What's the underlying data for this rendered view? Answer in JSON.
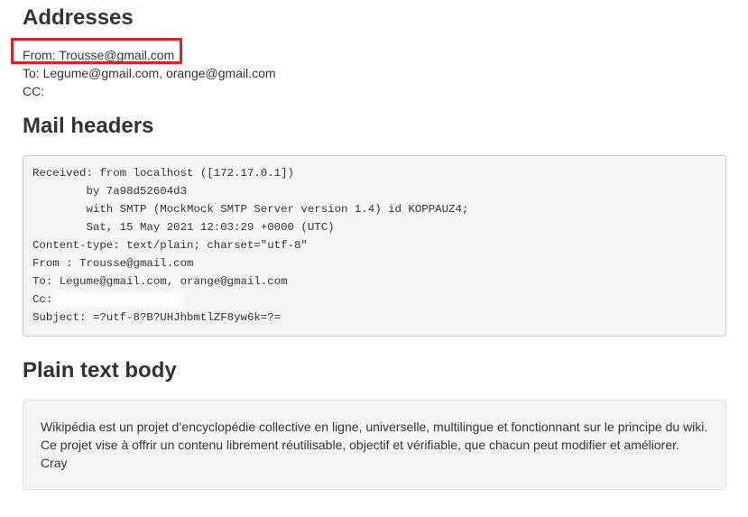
{
  "addresses": {
    "heading": "Addresses",
    "from": "From: Trousse@gmail.com",
    "to": "To: Legume@gmail.com, orange@gmail.com",
    "cc": "CC:"
  },
  "mail_headers": {
    "heading": "Mail headers",
    "lines": [
      "Received: from localhost ([172.17.0.1])",
      "        by 7a98d52604d3",
      "        with SMTP (MockMock SMTP Server version 1.4) id KOPPAUZ4;",
      "        Sat, 15 May 2021 12:03:29 +0000 (UTC)",
      "Content-type: text/plain; charset=\"utf-8\"",
      "From : Trousse@gmail.com",
      "To: Legume@gmail.com, orange@gmail.com",
      "Cc:",
      "Subject: =?utf-8?B?UHJhbmtlZF8yw6k=?="
    ]
  },
  "plain_text_body": {
    "heading": "Plain text body",
    "lines": [
      "Wikipédia est un projet d’encyclopédie collective en ligne, universelle, multilingue et fonctionnant sur le principe du wiki.",
      "Ce projet vise à offrir un contenu librement réutilisable, objectif et vérifiable, que chacun peut modifier et améliorer.",
      "Cray"
    ]
  },
  "annotation": {
    "highlight_color": "#d9232a"
  }
}
